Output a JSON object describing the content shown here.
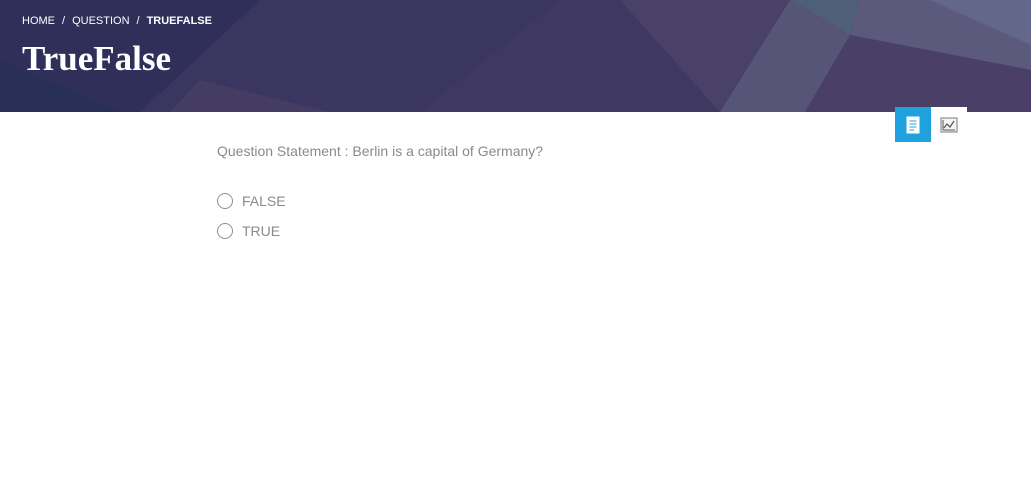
{
  "breadcrumb": {
    "home": "HOME",
    "separator_1": "/",
    "question": "QUESTION",
    "separator_2": "/",
    "current": "TRUEFALSE"
  },
  "page": {
    "title": "TrueFalse"
  },
  "view_toggle": {
    "buttons": [
      {
        "icon": "document-icon",
        "active": true
      },
      {
        "icon": "chart-icon",
        "active": false
      }
    ]
  },
  "question": {
    "statement": "Question Statement : Berlin is a capital of Germany?",
    "options": [
      {
        "label": "FALSE",
        "selected": false
      },
      {
        "label": "TRUE",
        "selected": false
      }
    ]
  },
  "colors": {
    "hero_background": "#3a3558",
    "accent": "#1ea1dc",
    "text_muted": "#8a8a8a"
  }
}
